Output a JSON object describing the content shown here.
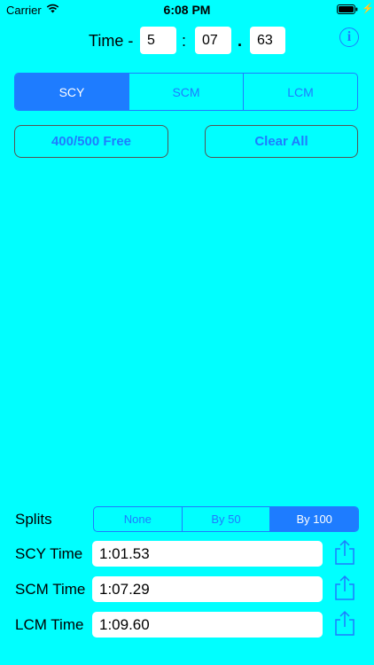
{
  "status": {
    "carrier": "Carrier",
    "time": "6:08 PM"
  },
  "time_entry": {
    "label": "Time -",
    "minutes": "5",
    "sep1": ":",
    "seconds": "07",
    "sep2": ".",
    "hundredths": "63"
  },
  "course_tabs": [
    {
      "label": "SCY",
      "selected": true
    },
    {
      "label": "SCM",
      "selected": false
    },
    {
      "label": "LCM",
      "selected": false
    }
  ],
  "buttons": {
    "free": "400/500 Free",
    "clear": "Clear All"
  },
  "splits": {
    "label": "Splits",
    "options": [
      {
        "label": "None",
        "selected": false
      },
      {
        "label": "By 50",
        "selected": false
      },
      {
        "label": "By 100",
        "selected": true
      }
    ]
  },
  "results": [
    {
      "label": "SCY Time",
      "value": "1:01.53"
    },
    {
      "label": "SCM Time",
      "value": "1:07.29"
    },
    {
      "label": "LCM Time",
      "value": "1:09.60"
    }
  ],
  "colors": {
    "background": "#00FFFF",
    "accent": "#1E7CFF"
  },
  "icons": {
    "info": "info-icon",
    "share": "share-icon",
    "wifi": "wifi-icon",
    "battery": "battery-icon"
  }
}
